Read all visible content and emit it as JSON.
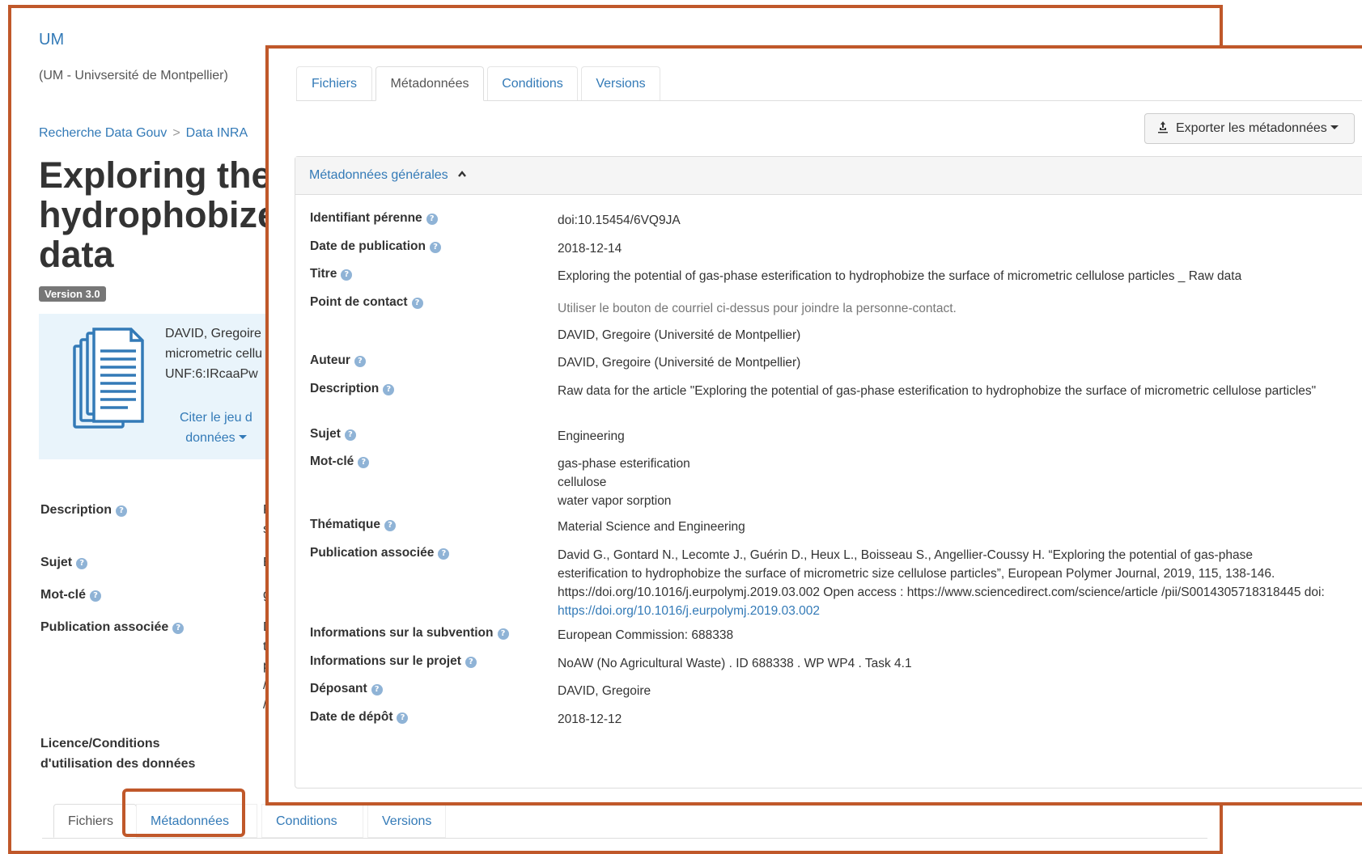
{
  "background_page": {
    "installation": "UM",
    "installation_subtitle": "(UM - Univsersité de Montpellier)",
    "breadcrumb": [
      "Recherche Data Gouv",
      "Data INRA"
    ],
    "breadcrumb_separator": ">",
    "title_lines": [
      "Exploring the",
      "hydrophobize",
      "data"
    ],
    "version_badge": "Version 3.0",
    "citation_lines": [
      "DAVID, Gregoire",
      "micrometric cellu",
      "UNF:6:IRcaaPw"
    ],
    "cite_link_lines": [
      "Citer le jeu d",
      "données"
    ],
    "labels": {
      "description": "Description",
      "sujet": "Sujet",
      "motcle": "Mot-clé",
      "publication": "Publication associée",
      "licence_lines": [
        "Licence/Conditions",
        "d'utilisation des données"
      ]
    },
    "truncated_values": [
      "R",
      "s",
      "E",
      "g",
      "D",
      "t",
      "p",
      "/",
      "/"
    ],
    "tabs": [
      "Fichiers",
      "Métadonnées",
      "Conditions",
      "Versions"
    ]
  },
  "metadata_panel": {
    "tabs": [
      "Fichiers",
      "Métadonnées",
      "Conditions",
      "Versions"
    ],
    "active_tab": "Métadonnées",
    "export_button": "Exporter les métadonnées",
    "section_title": "Métadonnées générales",
    "fields": {
      "identifiant": {
        "label": "Identifiant pérenne",
        "value": "doi:10.15454/6VQ9JA"
      },
      "date_pub": {
        "label": "Date de publication",
        "value": "2018-12-14"
      },
      "titre": {
        "label": "Titre",
        "value": "Exploring the potential of gas-phase esterification to hydrophobize the surface of micrometric cellulose particles _ Raw data"
      },
      "contact": {
        "label": "Point de contact",
        "note": "Utiliser le bouton de courriel ci-dessus pour joindre la personne-contact.",
        "value": "DAVID, Gregoire (Université de Montpellier)"
      },
      "auteur": {
        "label": "Auteur",
        "value": "DAVID, Gregoire (Université de Montpellier)"
      },
      "description": {
        "label": "Description",
        "value": "Raw data for the article \"Exploring the potential of gas-phase esterification to hydrophobize the surface of micrometric cellulose particles\""
      },
      "sujet": {
        "label": "Sujet",
        "value": "Engineering"
      },
      "motcle": {
        "label": "Mot-clé",
        "values": [
          "gas-phase esterification",
          "cellulose",
          "water vapor sorption"
        ]
      },
      "thematique": {
        "label": "Thématique",
        "value": "Material Science and Engineering"
      },
      "publication": {
        "label": "Publication associée",
        "text": "David G., Gontard N., Lecomte J., Guérin D., Heux L., Boisseau S., Angellier-Coussy H. “Exploring the potential of gas-phase esterification to hydrophobize the surface of micrometric size cellulose particles”, European Polymer Journal, 2019, 115, 138-146. https://doi.org/10.1016/j.eurpolymj.2019.03.002 Open access : https://www.sciencedirect.com/science/article /pii/S0014305718318445 doi: ",
        "link": "https://doi.org/10.1016/j.eurpolymj.2019.03.002"
      },
      "subvention": {
        "label": "Informations sur la subvention",
        "value": "European Commission: 688338"
      },
      "projet": {
        "label": "Informations sur le projet",
        "value": "NoAW (No Agricultural Waste) . ID 688338 . WP WP4 . Task 4.1"
      },
      "deposant": {
        "label": "Déposant",
        "value": "DAVID, Gregoire"
      },
      "date_depot": {
        "label": "Date de dépôt",
        "value": "2018-12-12"
      }
    }
  },
  "colors": {
    "highlight_border": "#c0582a",
    "link": "#337ab7",
    "cite_box_bg": "#e9f4fb"
  },
  "help_icon_glyph": "?"
}
